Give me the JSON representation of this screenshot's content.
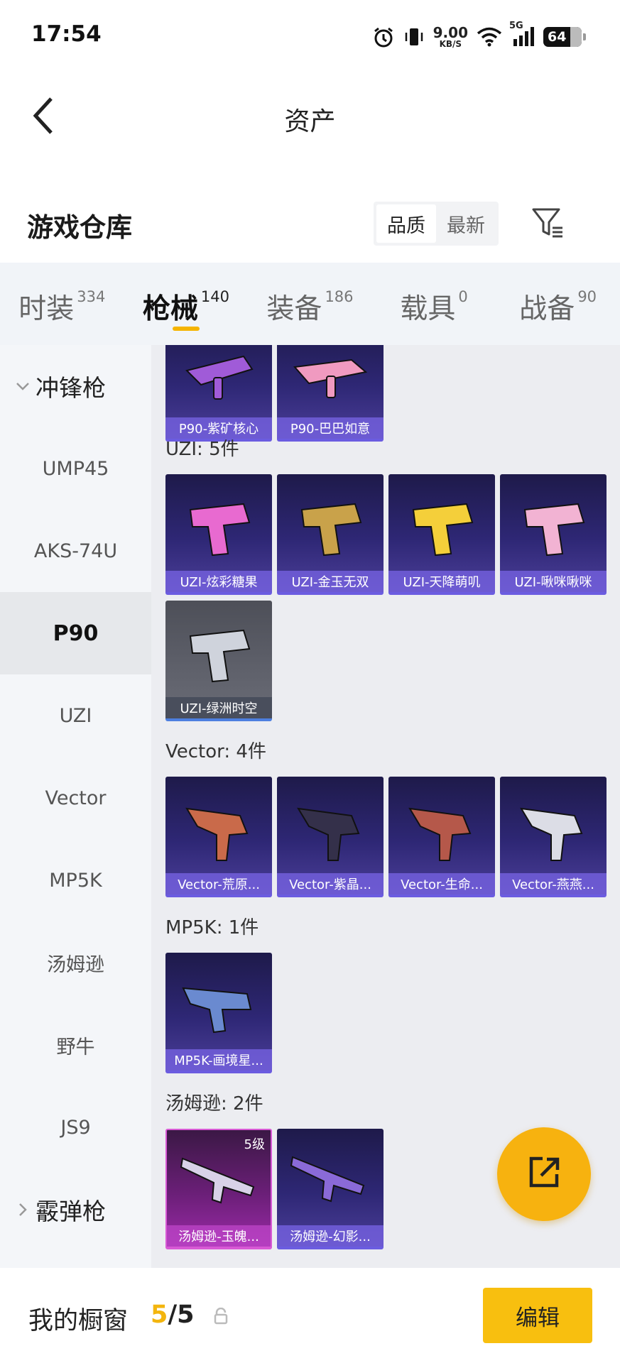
{
  "status_bar": {
    "time": "17:54",
    "net_speed_value": "9.00",
    "net_speed_unit": "KB/S",
    "network_type": "5G",
    "battery": "64",
    "icons": [
      "alarm-icon",
      "vibrate-icon",
      "wifi-icon",
      "signal-icon",
      "battery-icon"
    ]
  },
  "header": {
    "title": "资产",
    "back_icon": "chevron-left-icon"
  },
  "warehouse": {
    "title": "游戏仓库",
    "sort_options": [
      {
        "label": "品质",
        "active": true
      },
      {
        "label": "最新",
        "active": false
      }
    ],
    "filter_icon": "filter-icon"
  },
  "tabs": [
    {
      "label": "时装",
      "count": "334",
      "active": false
    },
    {
      "label": "枪械",
      "count": "140",
      "active": true
    },
    {
      "label": "装备",
      "count": "186",
      "active": false
    },
    {
      "label": "载具",
      "count": "0",
      "active": false
    },
    {
      "label": "战备",
      "count": "90",
      "active": false
    }
  ],
  "sidebar": {
    "group_smg": "冲锋枪",
    "items": [
      {
        "label": "UMP45",
        "active": false
      },
      {
        "label": "AKS-74U",
        "active": false
      },
      {
        "label": "P90",
        "active": true
      },
      {
        "label": "UZI",
        "active": false
      },
      {
        "label": "Vector",
        "active": false
      },
      {
        "label": "MP5K",
        "active": false
      },
      {
        "label": "汤姆逊",
        "active": false
      },
      {
        "label": "野牛",
        "active": false
      },
      {
        "label": "JS9",
        "active": false
      }
    ],
    "group_shotgun": "霰弹枪"
  },
  "content": {
    "p90_cards": [
      {
        "label": "P90-紫矿核心",
        "color": "#a05bd8"
      },
      {
        "label": "P90-巴巴如意",
        "color": "#f09ac0"
      }
    ],
    "uzi_title": "UZI: 5件",
    "uzi_cards": [
      {
        "label": "UZI-炫彩糖果",
        "color": "#e86ad0"
      },
      {
        "label": "UZI-金玉无双",
        "color": "#c9a24a"
      },
      {
        "label": "UZI-天降萌叽",
        "color": "#f4cf3a"
      },
      {
        "label": "UZI-啾咪啾咪",
        "color": "#f2b3d3"
      },
      {
        "label": "UZI-绿洲时空",
        "color": "#cfd3dc"
      }
    ],
    "vector_title": "Vector: 4件",
    "vector_cards": [
      {
        "label": "Vector-荒原...",
        "color": "#c96a4a"
      },
      {
        "label": "Vector-紫晶...",
        "color": "#34304a"
      },
      {
        "label": "Vector-生命...",
        "color": "#b5584a"
      },
      {
        "label": "Vector-燕燕...",
        "color": "#dcdde6"
      }
    ],
    "mp5k_title": "MP5K: 1件",
    "mp5k_cards": [
      {
        "label": "MP5K-画境星...",
        "color": "#6a8ad0"
      }
    ],
    "thompson_title": "汤姆逊: 2件",
    "thompson_cards": [
      {
        "label": "汤姆逊-玉魄...",
        "color": "#d8d2e8",
        "level": "5级"
      },
      {
        "label": "汤姆逊-幻影...",
        "color": "#8a6ad8"
      }
    ]
  },
  "fab": {
    "icon": "share-icon"
  },
  "bottom_bar": {
    "title": "我的橱窗",
    "current": "5",
    "separator": "/",
    "total": "5",
    "lock_icon": "lock-icon",
    "edit_label": "编辑"
  },
  "colors": {
    "accent": "#f5b400",
    "card_bg": "#2e2775",
    "card_label_bg": "#7864e6"
  }
}
